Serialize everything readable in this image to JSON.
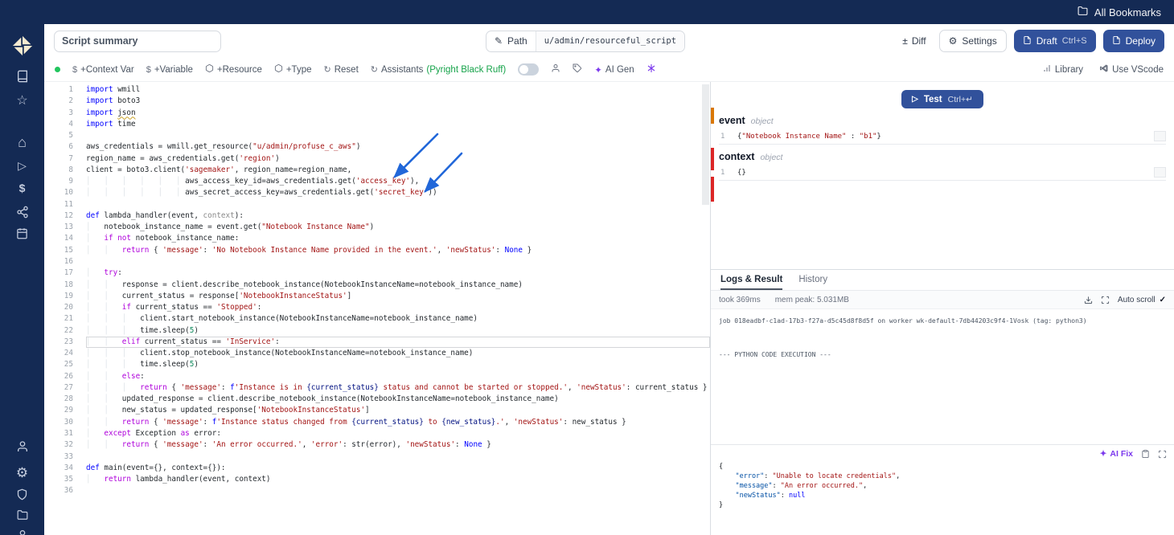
{
  "colors": {
    "navy": "#142a54",
    "primary": "#31519b",
    "violet": "#7c3aed",
    "green": "#16a34a",
    "dot": "#22c55e",
    "arrow": "#2167d9",
    "orange": "#d97706",
    "red": "#dc2626"
  },
  "icons": {
    "pencil": "✎",
    "diff": "±",
    "gear": "⚙",
    "play": "▷",
    "check": "✓",
    "refresh": "↻",
    "sparkle": "✦",
    "dollar": "$",
    "star": "☆",
    "home": "⌂"
  },
  "browser": {
    "all_bookmarks": "All Bookmarks"
  },
  "header": {
    "summary_value": "Script summary",
    "path_label": "Path",
    "path_value": "u/admin/resourceful_script",
    "diff_label": "Diff",
    "settings_label": "Settings",
    "draft_label": "Draft",
    "draft_shortcut": "Ctrl+S",
    "deploy_label": "Deploy"
  },
  "toolbar": {
    "context_var": "+Context Var",
    "variable": "+Variable",
    "resource": "+Resource",
    "type": "+Type",
    "reset": "Reset",
    "assistants": "Assistants",
    "assistants_detail": "(Pyright Black Ruff)",
    "ai_gen": "AI Gen",
    "library": "Library",
    "use_vscode": "Use VScode"
  },
  "editor": {
    "current_line": 23,
    "lines": [
      [
        [
          "k",
          "import"
        ],
        [
          "p",
          " wmill"
        ]
      ],
      [
        [
          "k",
          "import"
        ],
        [
          "p",
          " boto3"
        ]
      ],
      [
        [
          "k",
          "import"
        ],
        [
          "p",
          " "
        ],
        [
          "w",
          "json"
        ]
      ],
      [
        [
          "k",
          "import"
        ],
        [
          "p",
          " time"
        ]
      ],
      [],
      [
        [
          "p",
          "aws_credentials = wmill.get_resource("
        ],
        [
          "s",
          "\"u/admin/profuse_c_aws\""
        ],
        [
          "p",
          ")"
        ]
      ],
      [
        [
          "p",
          "region_name = aws_credentials.get("
        ],
        [
          "s",
          "'region'"
        ],
        [
          "p",
          ")"
        ]
      ],
      [
        [
          "p",
          "client = boto3.client("
        ],
        [
          "s",
          "'sagemaker'"
        ],
        [
          "p",
          ", region_name=region_name,"
        ]
      ],
      [
        [
          "p",
          "                      aws_access_key_id=aws_credentials.get("
        ],
        [
          "s",
          "'access_key'"
        ],
        [
          "p",
          "),"
        ]
      ],
      [
        [
          "p",
          "                      aws_secret_access_key=aws_credentials.get("
        ],
        [
          "s",
          "'secret_key'"
        ],
        [
          "p",
          "))"
        ]
      ],
      [],
      [
        [
          "k",
          "def"
        ],
        [
          "p",
          " lambda_handler(event, "
        ],
        [
          "d",
          "context"
        ],
        [
          "p",
          "):"
        ]
      ],
      [
        [
          "p",
          "    notebook_instance_name = event.get("
        ],
        [
          "s",
          "\"Notebook Instance Name\""
        ],
        [
          "p",
          ")"
        ]
      ],
      [
        [
          "p",
          "    "
        ],
        [
          "c",
          "if"
        ],
        [
          "p",
          " "
        ],
        [
          "c",
          "not"
        ],
        [
          "p",
          " notebook_instance_name:"
        ]
      ],
      [
        [
          "p",
          "        "
        ],
        [
          "c",
          "return"
        ],
        [
          "p",
          " { "
        ],
        [
          "s",
          "'message'"
        ],
        [
          "p",
          ": "
        ],
        [
          "s",
          "'No Notebook Instance Name provided in the event.'"
        ],
        [
          "p",
          ", "
        ],
        [
          "s",
          "'newStatus'"
        ],
        [
          "p",
          ": "
        ],
        [
          "k",
          "None"
        ],
        [
          "p",
          " }"
        ]
      ],
      [],
      [
        [
          "p",
          "    "
        ],
        [
          "c",
          "try"
        ],
        [
          "p",
          ":"
        ]
      ],
      [
        [
          "p",
          "        response = client.describe_notebook_instance(NotebookInstanceName=notebook_instance_name)"
        ]
      ],
      [
        [
          "p",
          "        current_status = response["
        ],
        [
          "s",
          "'NotebookInstanceStatus'"
        ],
        [
          "p",
          "]"
        ]
      ],
      [
        [
          "p",
          "        "
        ],
        [
          "c",
          "if"
        ],
        [
          "p",
          " current_status == "
        ],
        [
          "s",
          "'Stopped'"
        ],
        [
          "p",
          ":"
        ]
      ],
      [
        [
          "p",
          "            client.start_notebook_instance(NotebookInstanceName=notebook_instance_name)"
        ]
      ],
      [
        [
          "p",
          "            time.sleep("
        ],
        [
          "n",
          "5"
        ],
        [
          "p",
          ")"
        ]
      ],
      [
        [
          "p",
          "        "
        ],
        [
          "c",
          "elif"
        ],
        [
          "p",
          " current_status == "
        ],
        [
          "s",
          "'InService'"
        ],
        [
          "p",
          ":"
        ]
      ],
      [
        [
          "p",
          "            client.stop_notebook_instance(NotebookInstanceName=notebook_instance_name)"
        ]
      ],
      [
        [
          "p",
          "            time.sleep("
        ],
        [
          "n",
          "5"
        ],
        [
          "p",
          ")"
        ]
      ],
      [
        [
          "p",
          "        "
        ],
        [
          "c",
          "else"
        ],
        [
          "p",
          ":"
        ]
      ],
      [
        [
          "p",
          "            "
        ],
        [
          "c",
          "return"
        ],
        [
          "p",
          " { "
        ],
        [
          "s",
          "'message'"
        ],
        [
          "p",
          ": "
        ],
        [
          "k",
          "f"
        ],
        [
          "s",
          "'Instance is in "
        ],
        [
          "e",
          "{current_status}"
        ],
        [
          "s",
          " status and cannot be started or stopped.'"
        ],
        [
          "p",
          ", "
        ],
        [
          "s",
          "'newStatus'"
        ],
        [
          "p",
          ": current_status }"
        ]
      ],
      [
        [
          "p",
          "        updated_response = client.describe_notebook_instance(NotebookInstanceName=notebook_instance_name)"
        ]
      ],
      [
        [
          "p",
          "        new_status = updated_response["
        ],
        [
          "s",
          "'NotebookInstanceStatus'"
        ],
        [
          "p",
          "]"
        ]
      ],
      [
        [
          "p",
          "        "
        ],
        [
          "c",
          "return"
        ],
        [
          "p",
          " { "
        ],
        [
          "s",
          "'message'"
        ],
        [
          "p",
          ": "
        ],
        [
          "k",
          "f"
        ],
        [
          "s",
          "'Instance status changed from "
        ],
        [
          "e",
          "{current_status}"
        ],
        [
          "s",
          " to "
        ],
        [
          "e",
          "{new_status}"
        ],
        [
          "s",
          ".'"
        ],
        [
          "p",
          ", "
        ],
        [
          "s",
          "'newStatus'"
        ],
        [
          "p",
          ": new_status }"
        ]
      ],
      [
        [
          "p",
          "    "
        ],
        [
          "c",
          "except"
        ],
        [
          "p",
          " Exception "
        ],
        [
          "c",
          "as"
        ],
        [
          "p",
          " error:"
        ]
      ],
      [
        [
          "p",
          "        "
        ],
        [
          "c",
          "return"
        ],
        [
          "p",
          " { "
        ],
        [
          "s",
          "'message'"
        ],
        [
          "p",
          ": "
        ],
        [
          "s",
          "'An error occurred.'"
        ],
        [
          "p",
          ", "
        ],
        [
          "s",
          "'error'"
        ],
        [
          "p",
          ": str(error), "
        ],
        [
          "s",
          "'newStatus'"
        ],
        [
          "p",
          ": "
        ],
        [
          "k",
          "None"
        ],
        [
          "p",
          " }"
        ]
      ],
      [],
      [
        [
          "k",
          "def"
        ],
        [
          "p",
          " main(event={}, context={}):"
        ]
      ],
      [
        [
          "p",
          "    "
        ],
        [
          "c",
          "return"
        ],
        [
          "p",
          " lambda_handler(event, context)"
        ]
      ],
      []
    ]
  },
  "test_panel": {
    "test_label": "Test",
    "test_shortcut": "Ctrl+↵",
    "args": [
      {
        "name": "event",
        "type": "object",
        "line_no": "1",
        "value_tokens": [
          [
            "p",
            "{"
          ],
          [
            "s",
            "\"Notebook Instance Name\""
          ],
          [
            "p",
            " : "
          ],
          [
            "s",
            "\"b1\""
          ],
          [
            "p",
            "}"
          ]
        ]
      },
      {
        "name": "context",
        "type": "object",
        "line_no": "1",
        "value_tokens": [
          [
            "p",
            "{}"
          ]
        ]
      }
    ]
  },
  "logs": {
    "tab_logs": "Logs & Result",
    "tab_history": "History",
    "took": "took 369ms",
    "mem": "mem peak: 5.031MB",
    "autoscroll": "Auto scroll",
    "lines": [
      "job 018eadbf-c1ad-17b3-f27a-d5c45d8f8d5f on worker wk-default-7db44203c9f4-1Vosk (tag: python3)",
      "",
      "--- PYTHON CODE EXECUTION ---"
    ],
    "ai_fix": "AI Fix",
    "result_lines": [
      [
        [
          "p",
          "{"
        ]
      ],
      [
        [
          "key",
          "    \"error\""
        ],
        [
          "p",
          ": "
        ],
        [
          "s",
          "\"Unable to locate credentials\""
        ],
        [
          "p",
          ","
        ]
      ],
      [
        [
          "key",
          "    \"message\""
        ],
        [
          "p",
          ": "
        ],
        [
          "s",
          "\"An error occurred.\""
        ],
        [
          "p",
          ","
        ]
      ],
      [
        [
          "key",
          "    \"newStatus\""
        ],
        [
          "p",
          ": "
        ],
        [
          "k",
          "null"
        ]
      ],
      [
        [
          "p",
          "}"
        ]
      ]
    ]
  }
}
